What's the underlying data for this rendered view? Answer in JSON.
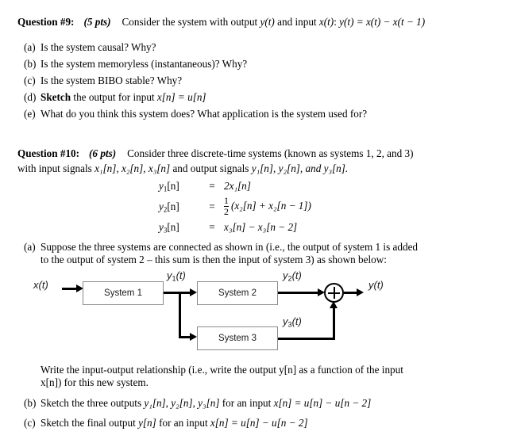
{
  "document": {
    "background_color": "#ffffff",
    "text_color": "#000000"
  },
  "question9": {
    "label": "Question #9:",
    "points": "(5 pts)",
    "prompt_pre": "Consider the system with output ",
    "prompt_y": "y(t)",
    "prompt_mid": " and input ",
    "prompt_x": "x(t)",
    "prompt_colon": ": ",
    "equation": "y(t) = x(t) − x(t − 1)",
    "items": [
      {
        "marker": "(a)",
        "text": "Is the system causal?  Why?"
      },
      {
        "marker": "(b)",
        "text": "Is the system memoryless (instantaneous)?  Why?"
      },
      {
        "marker": "(c)",
        "text": "Is the system BIBO stable?  Why?"
      },
      {
        "marker": "(d)",
        "bold_lead": "Sketch",
        "text": " the output for input ",
        "math": "x[n] = u[n]"
      },
      {
        "marker": "(e)",
        "text": "What do you think this system does?  What application is the system used for?"
      }
    ]
  },
  "question10": {
    "label": "Question #10:",
    "points": "(6 pts)",
    "intro_line1": "Consider three discrete-time systems (known as systems 1, 2, and 3)",
    "intro_line2_pre": "with input signals ",
    "intro_inputs": "x₁[n], x₂[n], x₃[n]",
    "intro_line2_mid": " and output signals ",
    "intro_outputs": "y₁[n], y₂[n], and y₃[n].",
    "equations": [
      {
        "lhs_base": "y",
        "lhs_sub": "1",
        "lhs_tail": "[n]",
        "eq": "=",
        "rhs": "2x₁[n]",
        "type": "plain"
      },
      {
        "lhs_base": "y",
        "lhs_sub": "2",
        "lhs_tail": "[n]",
        "eq": "=",
        "rhs_num": "1",
        "rhs_den": "2",
        "rhs_tail": "(x₂[n] + x₂[n − 1])",
        "type": "fraction"
      },
      {
        "lhs_base": "y",
        "lhs_sub": "3",
        "lhs_tail": "[n]",
        "eq": "=",
        "rhs": "x₃[n] − x₃[n − 2]",
        "type": "plain"
      }
    ],
    "item_a": {
      "marker": "(a)",
      "line1": "Suppose the three systems are connected as shown in (i.e., the output of system 1 is added",
      "line2": "to the output of system 2 – this sum is then the input of system 3) as shown below:"
    },
    "write_block": {
      "line1": "Write the input-output relationship (i.e., write the output y[n] as a function of the input",
      "line2": "x[n]) for this new system."
    },
    "item_b": {
      "marker": "(b)",
      "text_pre": "Sketch the three outputs ",
      "signals": "y₁[n], y₂[n], y₃[n]",
      "text_mid": " for an input ",
      "math": "x[n] = u[n] − u[n − 2]"
    },
    "item_c": {
      "marker": "(c)",
      "text_pre": "Sketch the final output ",
      "signal": "y[n]",
      "text_mid": " for an input ",
      "math": "x[n] = u[n] − u[n − 2]"
    }
  },
  "diagram": {
    "input_label": "x(t)",
    "output_label": "y(t)",
    "blocks": [
      {
        "name": "System 1",
        "label": "System 1"
      },
      {
        "name": "System 2",
        "label": "System 2"
      },
      {
        "name": "System 3",
        "label": "System 3"
      }
    ],
    "signals": [
      {
        "name": "y1",
        "base": "y",
        "sub": "1",
        "tail": "(t)"
      },
      {
        "name": "y2",
        "base": "y",
        "sub": "2",
        "tail": "(t)"
      },
      {
        "name": "y3",
        "base": "y",
        "sub": "3",
        "tail": "(t)"
      }
    ],
    "summing_node": "plus",
    "box_border_color": "#8a8a8a",
    "wire_color": "#000000"
  }
}
